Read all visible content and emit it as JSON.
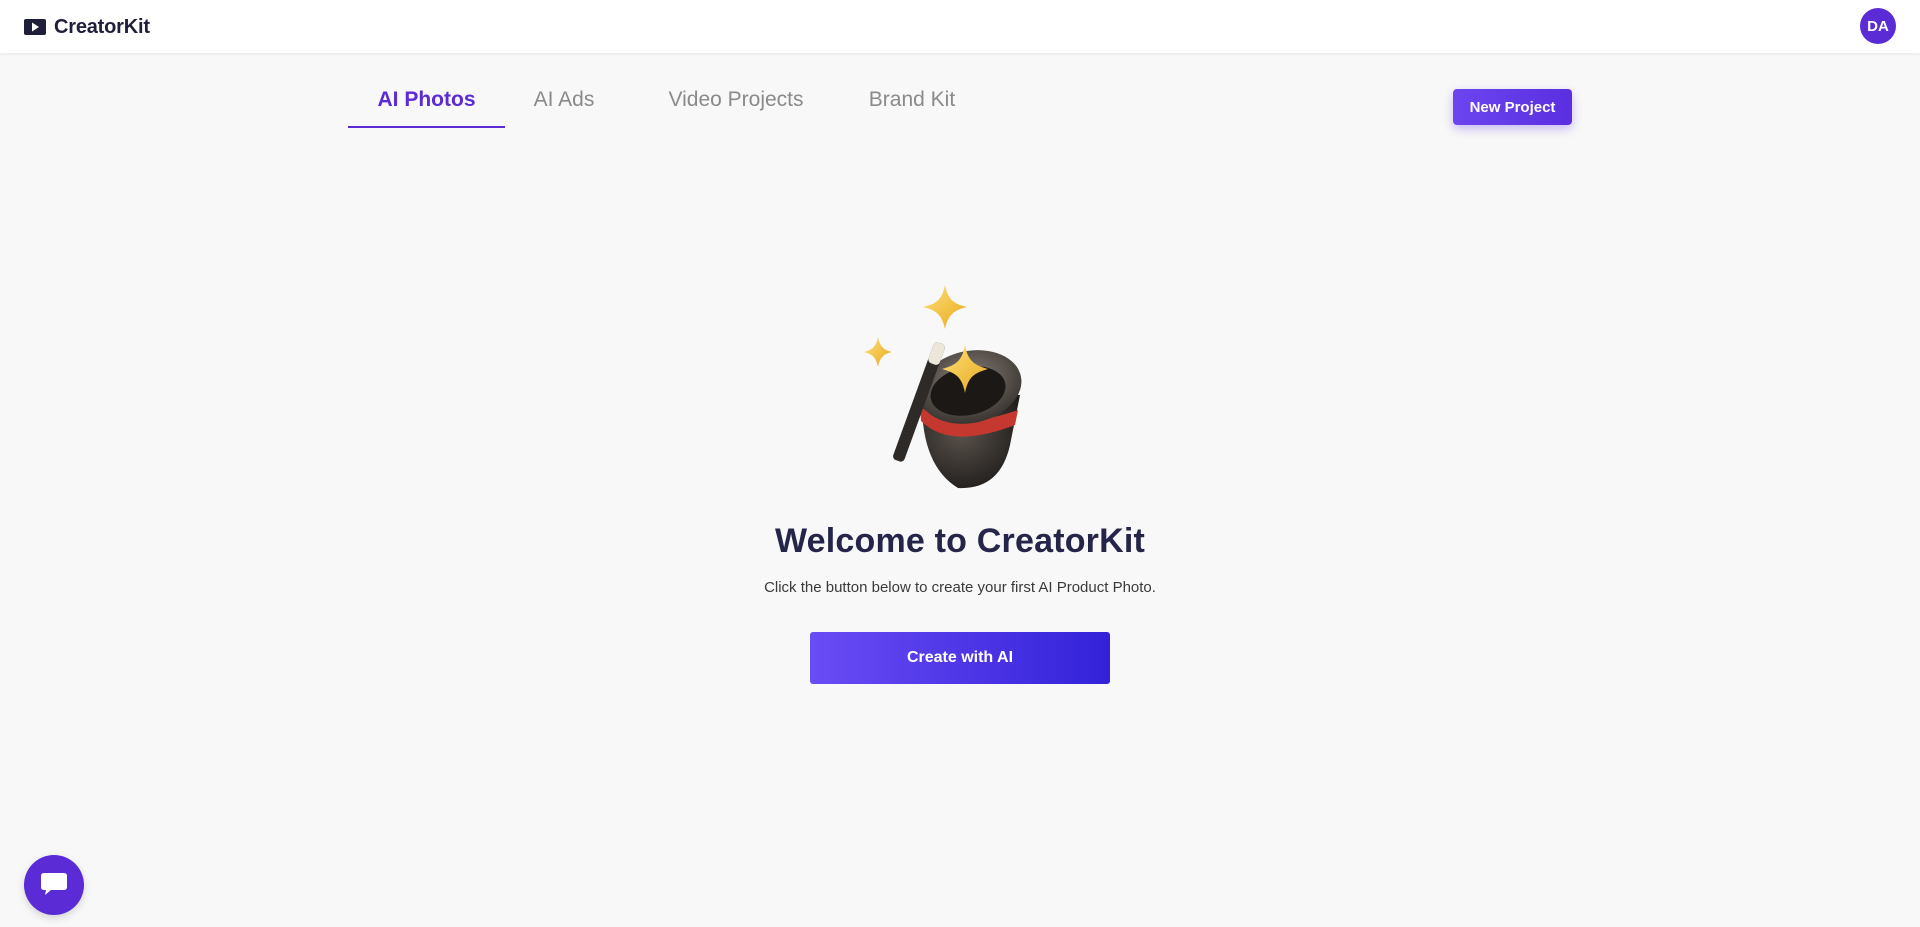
{
  "app": {
    "name": "CreatorKit",
    "logo_icon": "play-logo-icon",
    "user_initials": "DA",
    "accent_color": "#5b2bd6"
  },
  "tabs": [
    {
      "label": "AI Photos",
      "active": true
    },
    {
      "label": "AI Ads",
      "active": false
    },
    {
      "label": "Video Projects",
      "active": false
    },
    {
      "label": "Brand Kit",
      "active": false
    }
  ],
  "actions": {
    "new_project_label": "New Project"
  },
  "empty_state": {
    "illustration": "magic-hat-wand-icon",
    "title": "Welcome to CreatorKit",
    "subtitle": "Click the button below to create your first AI Product Photo.",
    "cta_label": "Create with AI"
  },
  "chat": {
    "icon": "chat-bubble-icon"
  }
}
